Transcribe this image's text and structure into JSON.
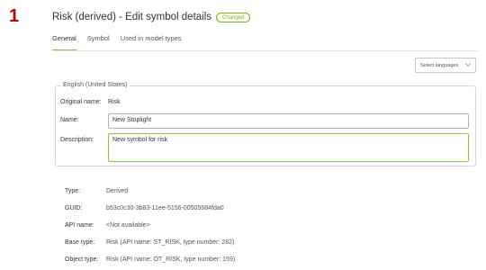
{
  "step_number": "1",
  "header": {
    "title": "Risk (derived) - Edit symbol details",
    "badge": "Changed"
  },
  "tabs": [
    {
      "label": "General",
      "active": true
    },
    {
      "label": "Symbol",
      "active": false
    },
    {
      "label": "Used in model types",
      "active": false
    }
  ],
  "language_select": {
    "label": "Select languages",
    "icon": "chevron-down-icon"
  },
  "language_section": {
    "legend": "English (United States)",
    "original_name_label": "Original name:",
    "original_name_value": "Risk",
    "name_label": "Name:",
    "name_value": "New Stoplight",
    "description_label": "Description:",
    "description_value": "New symbol for risk"
  },
  "details": [
    {
      "label": "Type:",
      "value": "Derived"
    },
    {
      "label": "GUID:",
      "value": "b53c0c30-3b83-11ee-5156-00505684fda0"
    },
    {
      "label": "API name:",
      "value": "<Not available>"
    },
    {
      "label": "Base type:",
      "value": "Risk (API name: ST_RISK, type number: 282)"
    },
    {
      "label": "Object type:",
      "value": "Risk (API name: OT_RISK, type number: 159)"
    }
  ],
  "colors": {
    "accent": "#8cc63f",
    "step_number": "#c00000",
    "badge": "#7ab317"
  }
}
